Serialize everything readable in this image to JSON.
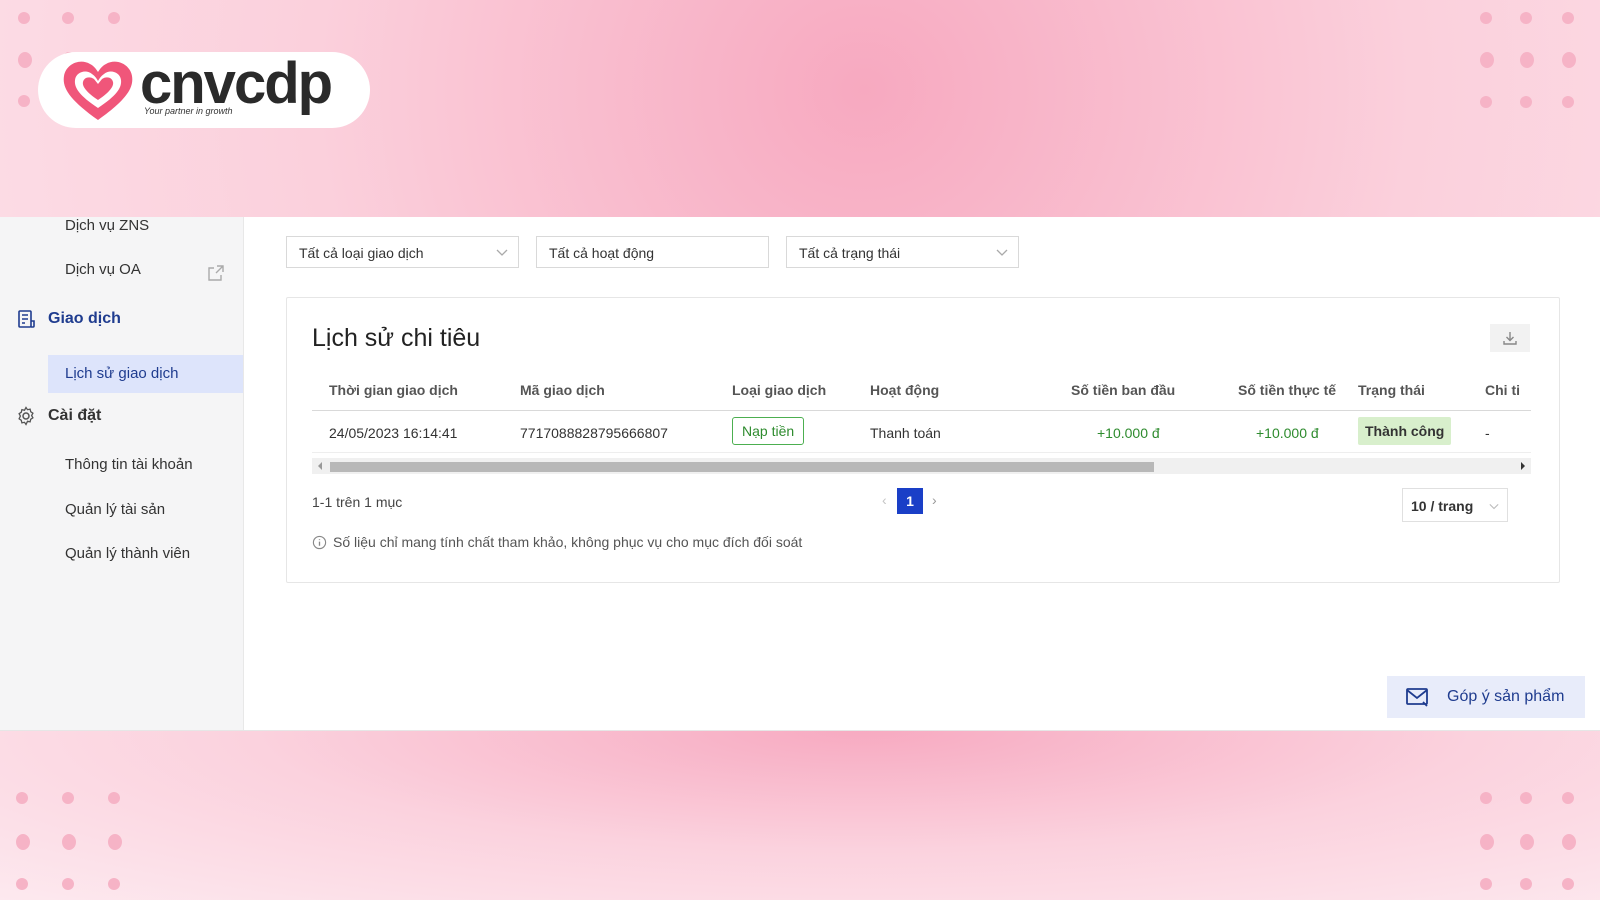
{
  "brand": {
    "name": "cnvcdp",
    "tagline": "Your partner in growth"
  },
  "sidebar": {
    "items": [
      {
        "label": "Dịch vụ ZNS",
        "type": "sub"
      },
      {
        "label": "Dịch vụ OA",
        "type": "sub",
        "icon": "external-link-icon"
      },
      {
        "label": "Giao dịch",
        "type": "group",
        "icon": "receipt-icon",
        "active": true
      },
      {
        "label": "Lịch sử giao dịch",
        "type": "sub",
        "active": true
      },
      {
        "label": "Cài đặt",
        "type": "group",
        "icon": "gear-icon"
      },
      {
        "label": "Thông tin tài khoản",
        "type": "sub"
      },
      {
        "label": "Quản lý tài sản",
        "type": "sub"
      },
      {
        "label": "Quản lý thành viên",
        "type": "sub"
      }
    ]
  },
  "filters": {
    "type": "Tất cả loại giao dịch",
    "activity": "Tất cả hoạt động",
    "status": "Tất cả trạng thái"
  },
  "card": {
    "title": "Lịch sử chi tiêu"
  },
  "table": {
    "columns": [
      "Thời gian giao dịch",
      "Mã giao dịch",
      "Loại giao dịch",
      "Hoạt động",
      "Số tiền ban đầu",
      "Số tiền thực tế",
      "Trạng thái",
      "Chi ti"
    ],
    "rows": [
      {
        "time": "24/05/2023 16:14:41",
        "code": "7717088828795666807",
        "type": "Nạp tiền",
        "activity": "Thanh toán",
        "amount_initial": "+10.000 đ",
        "amount_actual": "+10.000 đ",
        "status": "Thành công",
        "detail": "-"
      }
    ]
  },
  "pagination": {
    "summary": "1-1 trên 1 mục",
    "current": "1",
    "page_size": "10 / trang"
  },
  "note": "Số liệu chỉ mang tính chất tham khảo, không phục vụ cho mục đích đối soát",
  "feedback": {
    "label": "Góp ý sản phẩm"
  },
  "colors": {
    "accent": "#1a3fc7",
    "success": "#2e8b2e",
    "active_bg": "#dde4fb"
  }
}
